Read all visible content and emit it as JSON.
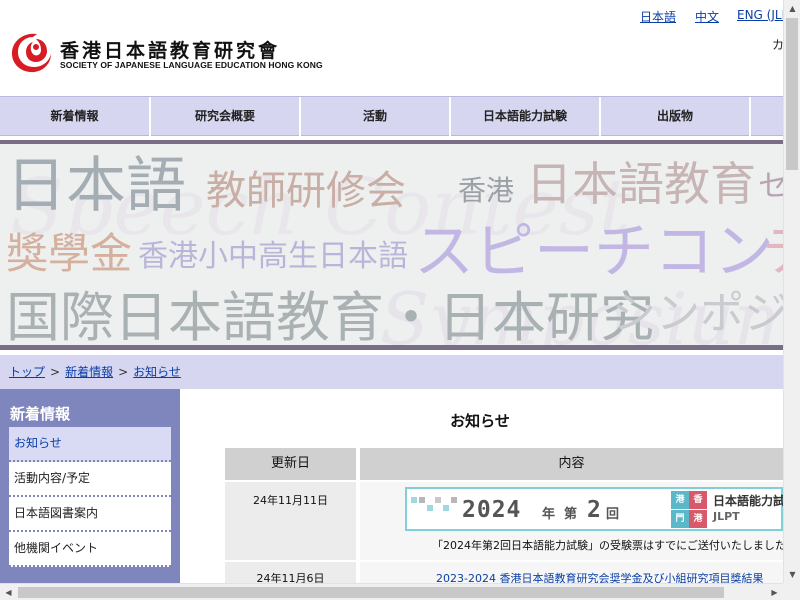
{
  "header": {
    "logo_jp": "香港日本語教育研究會",
    "logo_en": "SOCIETY OF JAPANESE LANGUAGE EDUCATION HONG KONG",
    "cut_text": "カ",
    "brand_colors": {
      "red": "#d81c24",
      "blue": "#1f3f97"
    }
  },
  "languages": [
    {
      "label": "日本語"
    },
    {
      "label": "中文"
    },
    {
      "label": "ENG (JLI"
    }
  ],
  "nav": [
    {
      "label": "新着情報"
    },
    {
      "label": "研究会概要"
    },
    {
      "label": "活動"
    },
    {
      "label": "日本語能力試験"
    },
    {
      "label": "出版物"
    },
    {
      "label": ""
    }
  ],
  "banner": {
    "row1": {
      "a": "日本語",
      "b": "教師研修会",
      "c": "香港",
      "d": "日本語教育",
      "e": "セ"
    },
    "row2": {
      "a": "獎學金",
      "b": "香港小中高生日本語",
      "c": "スピーチコン",
      "d": "テ"
    },
    "row3": {
      "a": "国際日本語教育・日本研究",
      "b": "シンポジ"
    },
    "script_1": "Speech Contest",
    "script_2": "Symposium"
  },
  "breadcrumb": [
    {
      "label": "トップ"
    },
    {
      "label": "新着情報"
    },
    {
      "label": "お知らせ"
    }
  ],
  "breadcrumb_separator": ">",
  "sidebar": {
    "title": "新着情報",
    "items": [
      {
        "label": "お知らせ"
      },
      {
        "label": "活動内容/予定"
      },
      {
        "label": "日本語図書案内"
      },
      {
        "label": "他機関イベント"
      }
    ]
  },
  "main": {
    "title": "お知らせ",
    "col_date": "更新日",
    "col_content": "内容",
    "rows": [
      {
        "date": "24年11月11日",
        "text": "「2024年第2回日本語能力試験」の受験票はすでにご送付いたしました。"
      },
      {
        "date": "24年11月6日",
        "text": "2023-2024 香港日本語教育研究会奨学金及び小組研究項目獎結果"
      }
    ]
  },
  "jlpt_banner": {
    "year": "2024",
    "nen": "年",
    "dai": "第",
    "num": "2",
    "kai": "回",
    "tiles": [
      "香",
      "港",
      "港",
      "門"
    ],
    "name": "日本語能力試",
    "brand": "JLPT"
  }
}
